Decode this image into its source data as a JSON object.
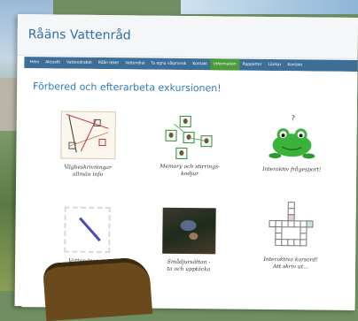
{
  "site": {
    "title": "Råäns Vattenråd"
  },
  "nav": {
    "items": [
      {
        "label": "Hem",
        "active": false
      },
      {
        "label": "Aktuellt",
        "active": false
      },
      {
        "label": "Vattendrabet",
        "active": false
      },
      {
        "label": "Råån leker",
        "active": false
      },
      {
        "label": "Vattendial",
        "active": false
      },
      {
        "label": "Ta egna vålprovok",
        "active": false
      },
      {
        "label": "Kontakt",
        "active": false
      },
      {
        "label": "Information",
        "active": true
      },
      {
        "label": "Rapporter",
        "active": false
      },
      {
        "label": "Länkar",
        "active": false
      },
      {
        "label": "Kontakt",
        "active": false
      }
    ],
    "accent": "#3d6e97",
    "active_color": "#4c9a3a"
  },
  "main": {
    "heading": "Förbered och efterarbeta exkursionen!",
    "tiles": [
      {
        "caption_line1": "Vägbeskrivningar",
        "caption_line2": "allmän info",
        "icon": "map-icon"
      },
      {
        "caption_line1": "Memory och stirrings-",
        "caption_line2": "kodjur",
        "icon": "memory-cards-icon"
      },
      {
        "caption_line1": "Interaktiv frågesport!",
        "caption_line2": "",
        "icon": "frog-icon"
      },
      {
        "caption_line1": "Vattendrag ...",
        "caption_line2": "",
        "icon": "blue-pen-letter-icon"
      },
      {
        "caption_line1": "Smådjursättan -",
        "caption_line2": "ta och upptäcka",
        "icon": "insect-photo-icon"
      },
      {
        "caption_line1": "Interaktiva korsord!",
        "caption_line2": "Att skriv ut...",
        "icon": "crossword-icon"
      }
    ]
  }
}
